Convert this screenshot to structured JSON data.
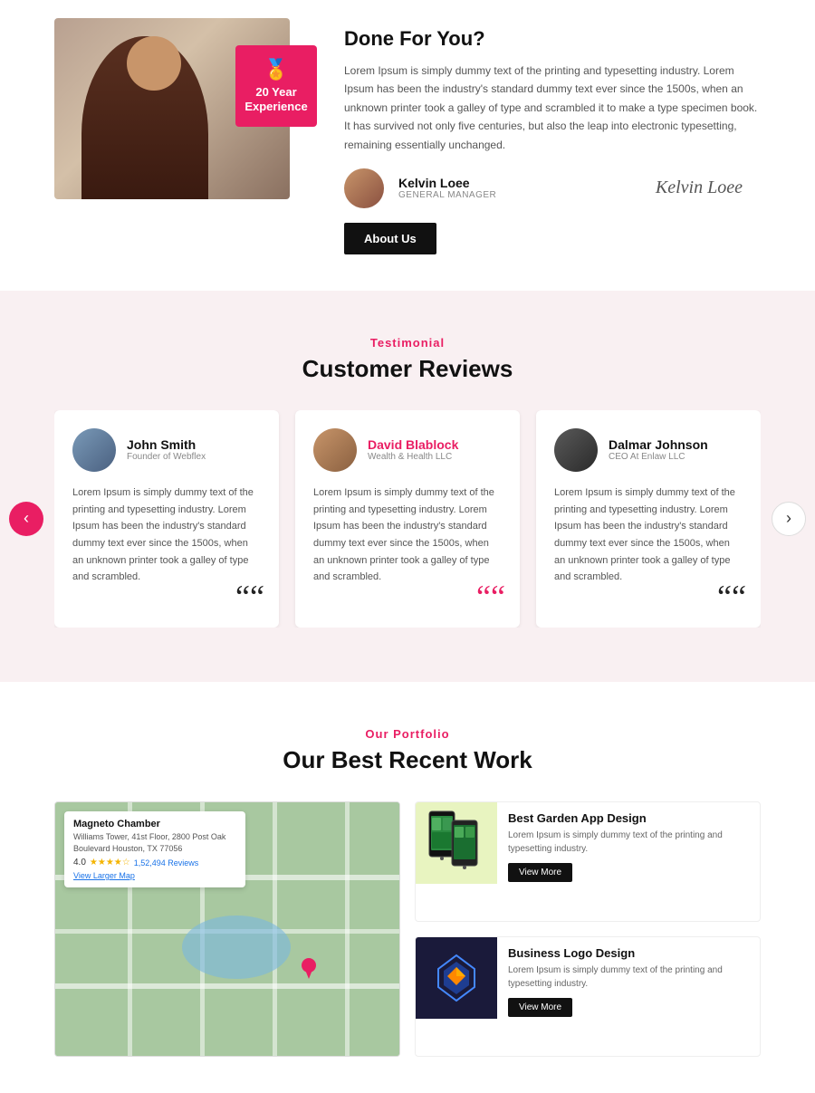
{
  "top": {
    "heading": "Done For You?",
    "body": "Lorem Ipsum is simply dummy text of the printing and typesetting industry. Lorem Ipsum has been the industry's standard dummy text ever since the 1500s, when an unknown printer took a galley of type and scrambled it to make a type specimen book. It has survived not only five centuries, but also the leap into electronic typesetting, remaining essentially unchanged.",
    "badge": {
      "icon": "🏅",
      "line1": "20 Year",
      "line2": "Experience"
    },
    "author": {
      "name": "Kelvin Loee",
      "title": "GENERAL MANAGER",
      "signature": "Kelvin Loee"
    },
    "about_btn": "About Us"
  },
  "testimonial": {
    "section_label": "Testimonial",
    "section_title": "Customer Reviews",
    "nav_left": "‹",
    "nav_right": "›",
    "cards": [
      {
        "name": "John Smith",
        "role": "Founder of Webflex",
        "text": "Lorem Ipsum is simply dummy text of the printing and typesetting industry. Lorem Ipsum has been the industry's standard dummy text ever since the 1500s, when an unknown printer took a galley of type and scrambled.",
        "quote": "““",
        "highlight": false
      },
      {
        "name": "David Blablock",
        "role": "Wealth & Health LLC",
        "text": "Lorem Ipsum is simply dummy text of the printing and typesetting industry. Lorem Ipsum has been the industry's standard dummy text ever since the 1500s, when an unknown printer took a galley of type and scrambled.",
        "quote": "““",
        "highlight": true
      },
      {
        "name": "Dalmar Johnson",
        "role": "CEO At Enlaw LLC",
        "text": "Lorem Ipsum is simply dummy text of the printing and typesetting industry. Lorem Ipsum has been the industry's standard dummy text ever since the 1500s, when an unknown printer took a galley of type and scrambled.",
        "quote": "““",
        "highlight": false
      }
    ]
  },
  "portfolio": {
    "section_label": "Our Portfolio",
    "section_title": "Our Best Recent Work",
    "map": {
      "business_name": "Magneto Chamber",
      "address": "Williams Tower, 41st Floor, 2800 Post Oak Boulevard Houston, TX 77056",
      "rating": "4.0",
      "reviews": "1,52,494 Reviews",
      "view_link": "View Larger Map"
    },
    "items": [
      {
        "title": "Best Garden App Design",
        "desc": "Lorem Ipsum is simply dummy text of the printing and typesetting industry.",
        "btn": "View More",
        "type": "garden"
      },
      {
        "title": "Business Logo Design",
        "desc": "Lorem Ipsum is simply dummy text of the printing and typesetting industry.",
        "btn": "View More",
        "type": "logo"
      }
    ]
  }
}
